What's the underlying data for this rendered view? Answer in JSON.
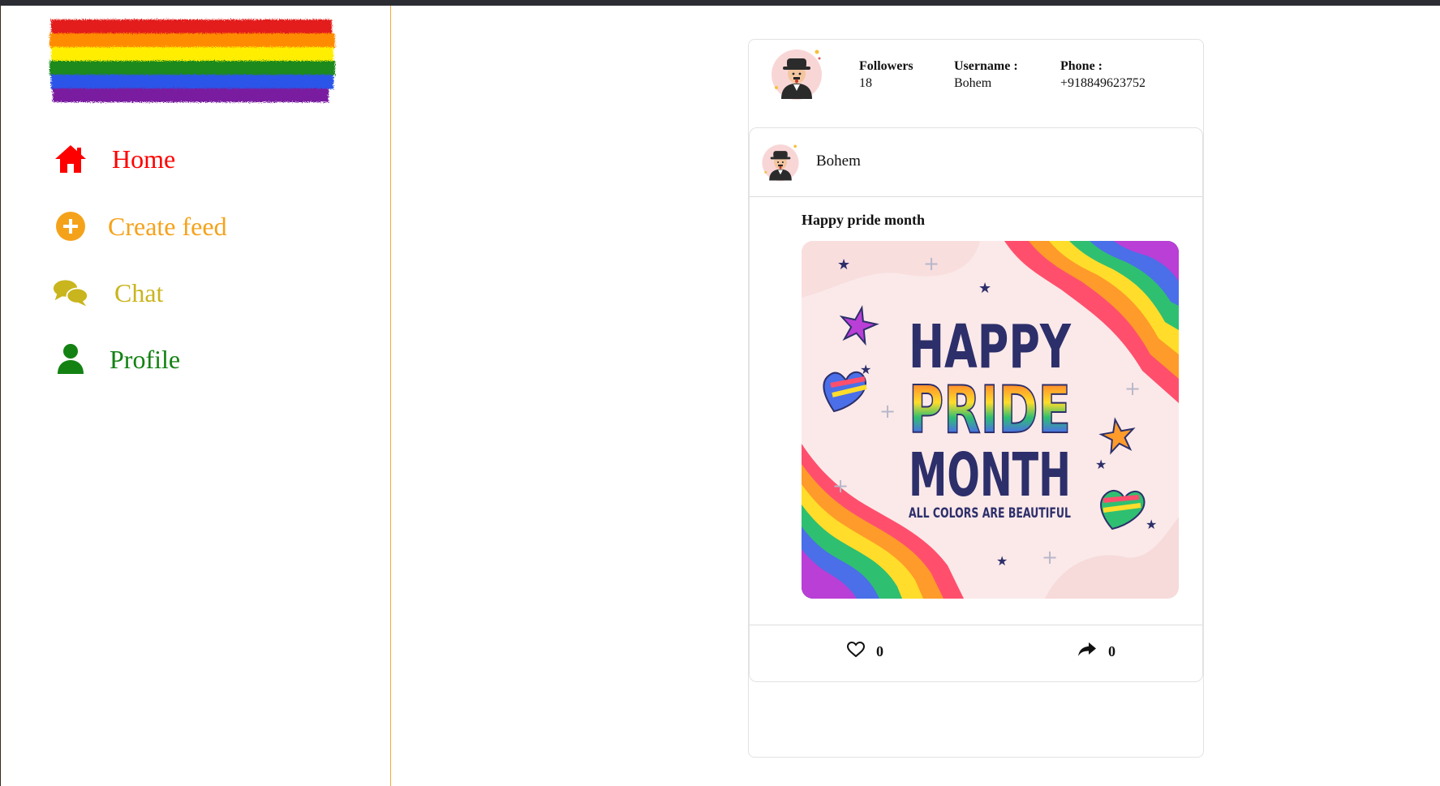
{
  "nav": {
    "items": [
      {
        "label": "Home",
        "icon": "home-icon",
        "color": "#ff0000"
      },
      {
        "label": "Create feed",
        "icon": "plus-circle-icon",
        "color": "#f5a21b"
      },
      {
        "label": "Chat",
        "icon": "chat-bubbles-icon",
        "color": "#c9b51d"
      },
      {
        "label": "Profile",
        "icon": "user-icon",
        "color": "#138213"
      }
    ]
  },
  "profile": {
    "followers_label": "Followers",
    "followers_value": "18",
    "username_label": "Username :",
    "username_value": "Bohem",
    "phone_label": "Phone :",
    "phone_value": "+918849623752"
  },
  "post": {
    "author": "Bohem",
    "title": "Happy pride month",
    "image_text": {
      "line1": "HAPPY",
      "line2": "PRIDE",
      "line3": "MONTH",
      "tagline": "ALL COLORS ARE BEAUTIFUL"
    },
    "likes": "0",
    "shares": "0"
  }
}
